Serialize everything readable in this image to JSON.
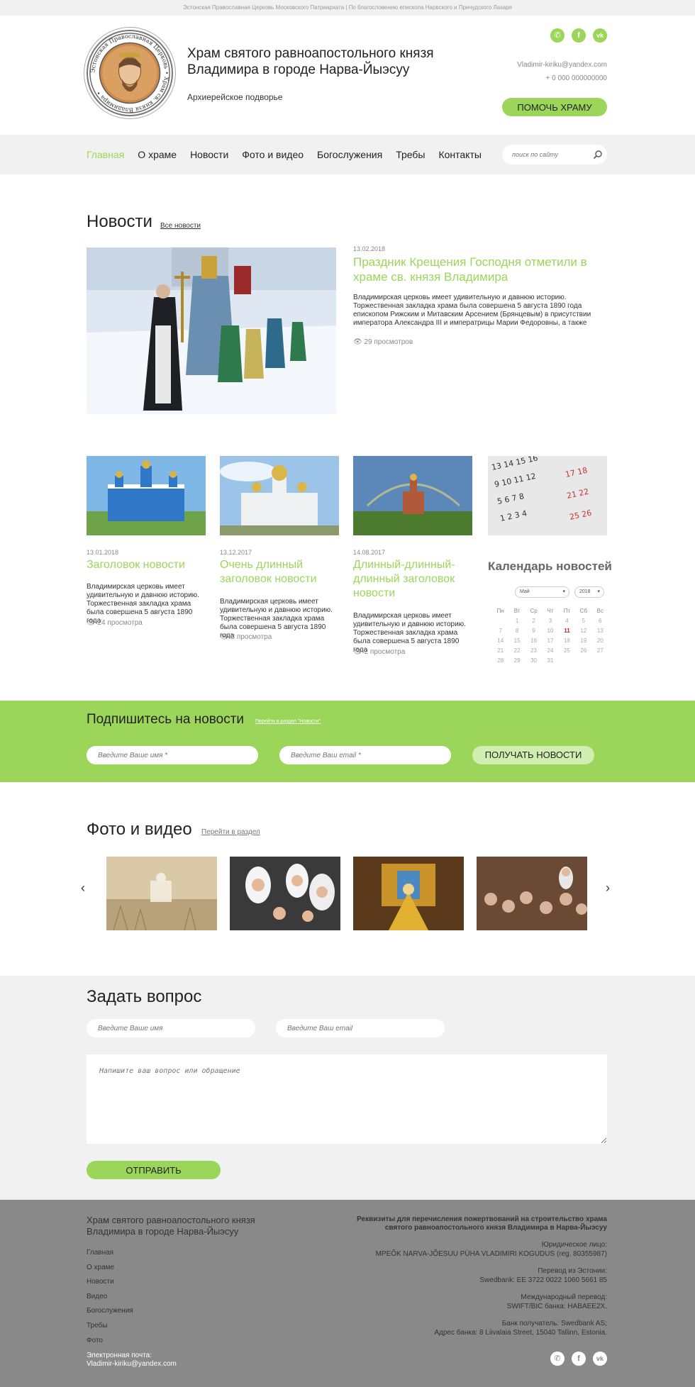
{
  "topbar": {
    "text": "Эстонская Православная Церковь Московского Патриархата | По благословению епископа Нарвского и Причудского Лазаря"
  },
  "header": {
    "title": "Храм святого равноапостольного князя Владимира в городе Нарва-Йыэсуу",
    "subtitle": "Архиерейское подворье",
    "logo_ring_text": "Эстонская Православная Церковь • Храм св. князя Владимира •",
    "email": "Vladimir-kiriku@yandex.com",
    "phone": "+ 0 000 000000000",
    "help_button": "ПОМОЧЬ ХРАМУ",
    "social": [
      {
        "icon": "whatsapp-icon",
        "glyph": "✆"
      },
      {
        "icon": "facebook-icon",
        "glyph": "f"
      },
      {
        "icon": "vk-icon",
        "glyph": "vk"
      }
    ]
  },
  "nav": {
    "items": [
      "Главная",
      "О храме",
      "Новости",
      "Фото и видео",
      "Богослужения",
      "Требы",
      "Контакты"
    ],
    "active": 0,
    "search_placeholder": "поиск по сайту"
  },
  "news": {
    "heading": "Новости",
    "all_link": "Все новости",
    "main": {
      "date": "13.02.2018",
      "title": "Праздник Крещения Господня отметили в храме св. князя Владимира",
      "text": "Владимирская церковь имеет удивительную и давнюю историю. Торжественная закладка храма была совершена 5 августа 1890 года епископом Рижским и Митавским Арсением (Брянцевым) в присутствии императора Александра III и императрицы Марии Федоровны, а также других",
      "views": "29 просмотров"
    },
    "cards": [
      {
        "date": "13.01.2018",
        "title": "Заголовок новости",
        "text": "Владимирская церковь имеет удивительную и давнюю историю. Торжественная закладка храма была совершена 5 августа 1890 года",
        "views": "24 просмотра"
      },
      {
        "date": "13.12.2017",
        "title": "Очень длинный заголовок новости",
        "text": "Владимирская церковь имеет удивительную и давнюю историю. Торжественная закладка храма была совершена 5 августа 1890 года",
        "views": "3 просмотра"
      },
      {
        "date": "14.08.2017",
        "title": "Длинный-длинный-длинный заголовок новости",
        "text": "Владимирская церковь имеет удивительную и давнюю историю. Торжественная закладка храма была совершена 5 августа 1890 года",
        "views": "2 просмотра"
      }
    ]
  },
  "calendar": {
    "title": "Календарь новостей",
    "month": "Май",
    "year": "2018",
    "weekdays": [
      "Пн",
      "Вт",
      "Ср",
      "Чт",
      "Пт",
      "Сб",
      "Вс"
    ],
    "days": [
      "",
      "1",
      "2",
      "3",
      "4",
      "5",
      "6",
      "7",
      "8",
      "9",
      "10",
      "11",
      "12",
      "13",
      "14",
      "15",
      "16",
      "17",
      "18",
      "19",
      "20",
      "21",
      "22",
      "23",
      "24",
      "25",
      "26",
      "27",
      "28",
      "29",
      "30",
      "31"
    ],
    "today": "11"
  },
  "subscribe": {
    "heading": "Подпишитесь на новости",
    "link": "Перейти в раздел \"Новости\"",
    "name_placeholder": "Введите Ваше имя *",
    "email_placeholder": "Введите Ваш email *",
    "button": "ПОЛУЧАТЬ НОВОСТИ"
  },
  "photos": {
    "heading": "Фото и видео",
    "link": "Перейти в раздел",
    "prev": "‹",
    "next": "›"
  },
  "ask": {
    "heading": "Задать вопрос",
    "name_placeholder": "Введите Ваше имя",
    "email_placeholder": "Введите Ваш email",
    "message_placeholder": "Напишите ваш вопрос или обращение",
    "button": "ОТПРАВИТЬ"
  },
  "footer": {
    "title": "Храм святого равноапостольного князя Владимира в городе Нарва-Йыэсуу",
    "links": [
      "Главная",
      "О храме",
      "Новости",
      "Видео",
      "Богослужения",
      "Требы",
      "Фото"
    ],
    "email_label": "Электронная почта:",
    "email": "Vladimir-kiriku@yandex.com",
    "req_title": "Реквизиты для перечисления пожертвований на строительство храма святого равноапостольного князя Владимира в Нарва-Йыэсуу",
    "legal_label": "Юридическое лицо:",
    "legal_value": "MPEÕK NARVA-JÕESUU PÜHA VLADIMIRI KOGUDUS (reg. 80355987)",
    "estonia_label": "Перевод из Эстонии:",
    "estonia_value": "Swedbank: EE 3722 0022 1060 5661 85",
    "intl_label": "Международный перевод:",
    "intl_value": "SWIFT/BIC банка: HABAEE2X.",
    "bank_label": "Банк получатель: Swedbank AS;",
    "bank_address": "Адрес банка: 8 Liivalaia Street, 15040 Tallinn, Estonia."
  }
}
